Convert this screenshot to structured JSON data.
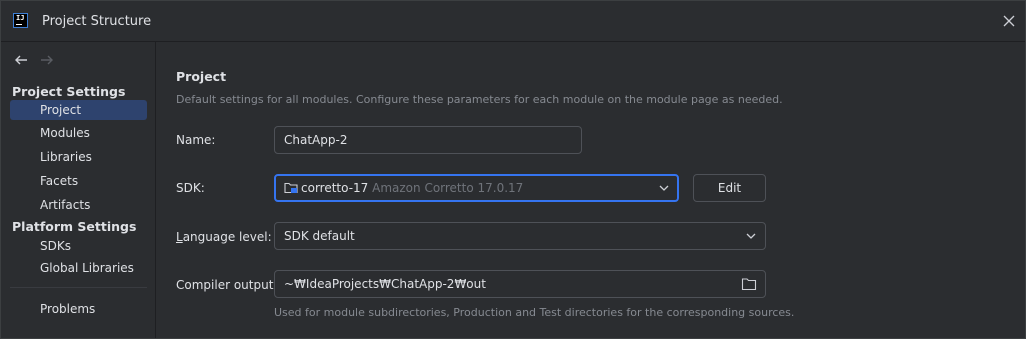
{
  "window": {
    "title": "Project Structure"
  },
  "sidebar": {
    "sections": [
      {
        "header": "Project Settings",
        "items": [
          "Project",
          "Modules",
          "Libraries",
          "Facets",
          "Artifacts"
        ]
      },
      {
        "header": "Platform Settings",
        "items": [
          "SDKs",
          "Global Libraries"
        ]
      }
    ],
    "problems": "Problems",
    "selected": "Project"
  },
  "page": {
    "title": "Project",
    "description": "Default settings for all modules. Configure these parameters for each module on the module page as needed."
  },
  "form": {
    "name_label": "Name:",
    "name_value": "ChatApp-2",
    "sdk_label": "SDK:",
    "sdk_name": "corretto-17",
    "sdk_detail": "Amazon Corretto 17.0.17",
    "edit_label": "Edit",
    "language_label_mnemonic": "L",
    "language_label_rest": "anguage level:",
    "language_value": "SDK default",
    "compiler_label": "Compiler output:",
    "compiler_value": "~₩IdeaProjects₩ChatApp-2₩out",
    "compiler_hint": "Used for module subdirectories, Production and Test directories for the corresponding sources."
  },
  "icons": {
    "app": "intellij-idea-icon",
    "close": "close-icon",
    "back": "back-arrow-icon",
    "forward": "forward-arrow-icon",
    "sdk": "sdk-folder-icon",
    "dropdown": "chevron-down-icon",
    "browse": "folder-icon"
  },
  "colors": {
    "background": "#2b2d30",
    "selection": "#2e436e",
    "focus_border": "#3574f0",
    "text": "#dfe1e5",
    "muted_text": "#868a91"
  }
}
